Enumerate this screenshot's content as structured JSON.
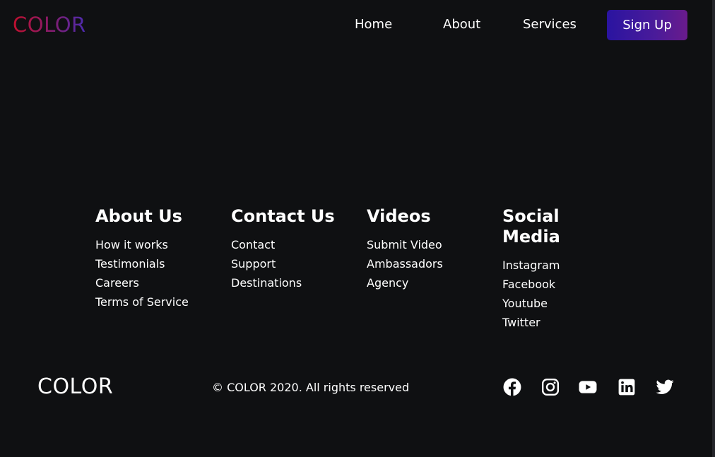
{
  "navbar": {
    "logo": "COLOR",
    "links": [
      "Home",
      "About",
      "Services"
    ],
    "signup_label": "Sign Up"
  },
  "footer": {
    "columns": [
      {
        "heading": "About Us",
        "links": [
          "How it works",
          "Testimonials",
          "Careers",
          "Terms of Service"
        ]
      },
      {
        "heading": "Contact Us",
        "links": [
          "Contact",
          "Support",
          "Destinations"
        ]
      },
      {
        "heading": "Videos",
        "links": [
          "Submit Video",
          "Ambassadors",
          "Agency"
        ]
      },
      {
        "heading": "Social Media",
        "links": [
          "Instagram",
          "Facebook",
          "Youtube",
          "Twitter"
        ]
      }
    ],
    "bottom_logo": "COLOR",
    "copyright": "© COLOR 2020. All rights reserved",
    "social_icons": [
      "facebook-icon",
      "instagram-icon",
      "youtube-icon",
      "linkedin-icon",
      "twitter-icon"
    ]
  },
  "colors": {
    "background": "#0f1012",
    "logo_gradient_start": "#c0102e",
    "logo_gradient_end": "#4a2bb0",
    "button_gradient_start": "#2a14a0",
    "button_gradient_end": "#6a1b8c",
    "text": "#ffffff"
  }
}
